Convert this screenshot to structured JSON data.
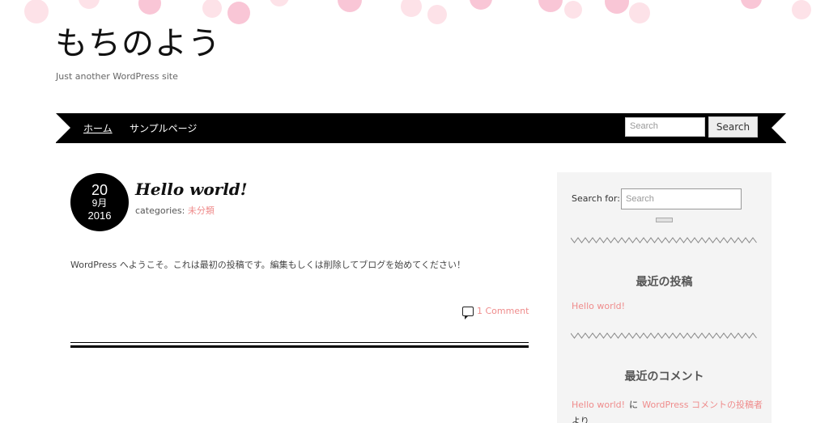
{
  "site": {
    "title": "もちのよう",
    "description": "Just another WordPress site"
  },
  "nav": {
    "items": [
      {
        "label": "ホーム",
        "active": true
      },
      {
        "label": "サンプルページ",
        "active": false
      }
    ],
    "search_placeholder": "Search",
    "search_button": "Search"
  },
  "post": {
    "date": {
      "day": "20",
      "month": "9月",
      "year": "2016"
    },
    "title": "Hello world!",
    "categories_label": "categories:",
    "category": "未分類",
    "body": "WordPress へようこそ。これは最初の投稿です。編集もしくは削除してブログを始めてください！",
    "comment_link": "1 Comment"
  },
  "sidebar": {
    "search_label": "Search for:",
    "search_placeholder": "Search",
    "recent_posts_heading": "最近の投稿",
    "recent_posts": [
      "Hello world!"
    ],
    "recent_comments_heading": "最近のコメント",
    "recent_comment": {
      "post": "Hello world!",
      "joiner": "に",
      "author": "WordPress コメントの投稿者",
      "suffix": "より"
    }
  },
  "colors": {
    "accent": "#ef8c8c",
    "nav_bg": "#000000",
    "sidebar_bg": "#f4f4f4",
    "dot_pink": "#f9c6d6",
    "dot_light": "#fde2e8"
  }
}
